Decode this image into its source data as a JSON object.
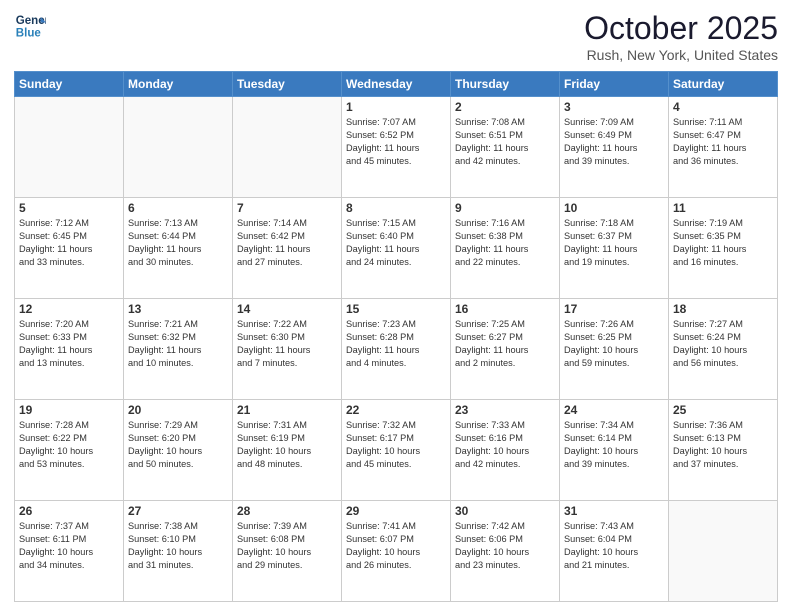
{
  "header": {
    "logo_line1": "General",
    "logo_line2": "Blue",
    "month": "October 2025",
    "location": "Rush, New York, United States"
  },
  "days_of_week": [
    "Sunday",
    "Monday",
    "Tuesday",
    "Wednesday",
    "Thursday",
    "Friday",
    "Saturday"
  ],
  "weeks": [
    [
      {
        "day": "",
        "info": ""
      },
      {
        "day": "",
        "info": ""
      },
      {
        "day": "",
        "info": ""
      },
      {
        "day": "1",
        "info": "Sunrise: 7:07 AM\nSunset: 6:52 PM\nDaylight: 11 hours\nand 45 minutes."
      },
      {
        "day": "2",
        "info": "Sunrise: 7:08 AM\nSunset: 6:51 PM\nDaylight: 11 hours\nand 42 minutes."
      },
      {
        "day": "3",
        "info": "Sunrise: 7:09 AM\nSunset: 6:49 PM\nDaylight: 11 hours\nand 39 minutes."
      },
      {
        "day": "4",
        "info": "Sunrise: 7:11 AM\nSunset: 6:47 PM\nDaylight: 11 hours\nand 36 minutes."
      }
    ],
    [
      {
        "day": "5",
        "info": "Sunrise: 7:12 AM\nSunset: 6:45 PM\nDaylight: 11 hours\nand 33 minutes."
      },
      {
        "day": "6",
        "info": "Sunrise: 7:13 AM\nSunset: 6:44 PM\nDaylight: 11 hours\nand 30 minutes."
      },
      {
        "day": "7",
        "info": "Sunrise: 7:14 AM\nSunset: 6:42 PM\nDaylight: 11 hours\nand 27 minutes."
      },
      {
        "day": "8",
        "info": "Sunrise: 7:15 AM\nSunset: 6:40 PM\nDaylight: 11 hours\nand 24 minutes."
      },
      {
        "day": "9",
        "info": "Sunrise: 7:16 AM\nSunset: 6:38 PM\nDaylight: 11 hours\nand 22 minutes."
      },
      {
        "day": "10",
        "info": "Sunrise: 7:18 AM\nSunset: 6:37 PM\nDaylight: 11 hours\nand 19 minutes."
      },
      {
        "day": "11",
        "info": "Sunrise: 7:19 AM\nSunset: 6:35 PM\nDaylight: 11 hours\nand 16 minutes."
      }
    ],
    [
      {
        "day": "12",
        "info": "Sunrise: 7:20 AM\nSunset: 6:33 PM\nDaylight: 11 hours\nand 13 minutes."
      },
      {
        "day": "13",
        "info": "Sunrise: 7:21 AM\nSunset: 6:32 PM\nDaylight: 11 hours\nand 10 minutes."
      },
      {
        "day": "14",
        "info": "Sunrise: 7:22 AM\nSunset: 6:30 PM\nDaylight: 11 hours\nand 7 minutes."
      },
      {
        "day": "15",
        "info": "Sunrise: 7:23 AM\nSunset: 6:28 PM\nDaylight: 11 hours\nand 4 minutes."
      },
      {
        "day": "16",
        "info": "Sunrise: 7:25 AM\nSunset: 6:27 PM\nDaylight: 11 hours\nand 2 minutes."
      },
      {
        "day": "17",
        "info": "Sunrise: 7:26 AM\nSunset: 6:25 PM\nDaylight: 10 hours\nand 59 minutes."
      },
      {
        "day": "18",
        "info": "Sunrise: 7:27 AM\nSunset: 6:24 PM\nDaylight: 10 hours\nand 56 minutes."
      }
    ],
    [
      {
        "day": "19",
        "info": "Sunrise: 7:28 AM\nSunset: 6:22 PM\nDaylight: 10 hours\nand 53 minutes."
      },
      {
        "day": "20",
        "info": "Sunrise: 7:29 AM\nSunset: 6:20 PM\nDaylight: 10 hours\nand 50 minutes."
      },
      {
        "day": "21",
        "info": "Sunrise: 7:31 AM\nSunset: 6:19 PM\nDaylight: 10 hours\nand 48 minutes."
      },
      {
        "day": "22",
        "info": "Sunrise: 7:32 AM\nSunset: 6:17 PM\nDaylight: 10 hours\nand 45 minutes."
      },
      {
        "day": "23",
        "info": "Sunrise: 7:33 AM\nSunset: 6:16 PM\nDaylight: 10 hours\nand 42 minutes."
      },
      {
        "day": "24",
        "info": "Sunrise: 7:34 AM\nSunset: 6:14 PM\nDaylight: 10 hours\nand 39 minutes."
      },
      {
        "day": "25",
        "info": "Sunrise: 7:36 AM\nSunset: 6:13 PM\nDaylight: 10 hours\nand 37 minutes."
      }
    ],
    [
      {
        "day": "26",
        "info": "Sunrise: 7:37 AM\nSunset: 6:11 PM\nDaylight: 10 hours\nand 34 minutes."
      },
      {
        "day": "27",
        "info": "Sunrise: 7:38 AM\nSunset: 6:10 PM\nDaylight: 10 hours\nand 31 minutes."
      },
      {
        "day": "28",
        "info": "Sunrise: 7:39 AM\nSunset: 6:08 PM\nDaylight: 10 hours\nand 29 minutes."
      },
      {
        "day": "29",
        "info": "Sunrise: 7:41 AM\nSunset: 6:07 PM\nDaylight: 10 hours\nand 26 minutes."
      },
      {
        "day": "30",
        "info": "Sunrise: 7:42 AM\nSunset: 6:06 PM\nDaylight: 10 hours\nand 23 minutes."
      },
      {
        "day": "31",
        "info": "Sunrise: 7:43 AM\nSunset: 6:04 PM\nDaylight: 10 hours\nand 21 minutes."
      },
      {
        "day": "",
        "info": ""
      }
    ]
  ]
}
